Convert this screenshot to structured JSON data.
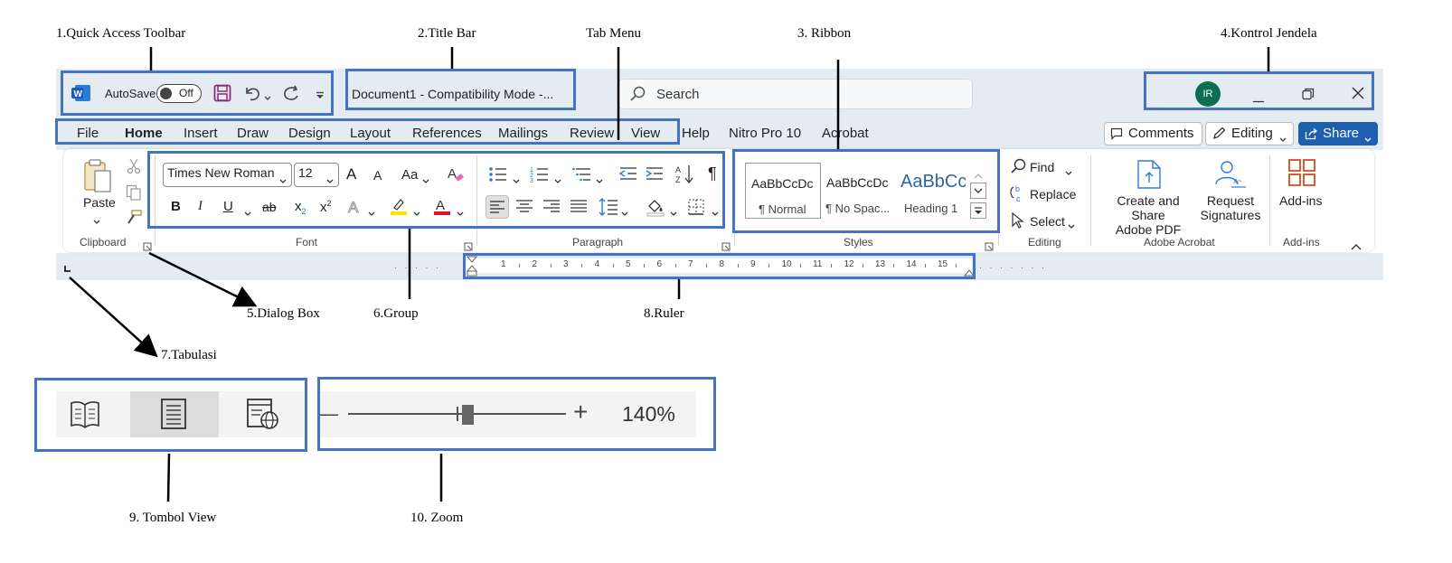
{
  "annotations": {
    "qat": "1.Quick Access Toolbar",
    "title_bar": "2.Title Bar",
    "tab_menu": "Tab Menu",
    "ribbon": "3. Ribbon",
    "window_controls": "4.Kontrol Jendela",
    "dialog_box": "5.Dialog Box",
    "group": "6.Group",
    "tabulasi": "7.Tabulasi",
    "ruler": "8.Ruler",
    "view_buttons": "9. Tombol View",
    "zoom": "10.  Zoom"
  },
  "window": {
    "autosave_label": "AutoSave",
    "autosave_state": "Off",
    "doc_title": "Document1  -  Compatibility Mode  -...",
    "search_placeholder": "Search",
    "avatar_initials": "IR"
  },
  "tabs": [
    "File",
    "Home",
    "Insert",
    "Draw",
    "Design",
    "Layout",
    "References",
    "Mailings",
    "Review",
    "View",
    "Help",
    "Nitro Pro 10",
    "Acrobat"
  ],
  "active_tab": "Home",
  "right_buttons": {
    "comments": "Comments",
    "editing": "Editing",
    "share": "Share"
  },
  "ribbon": {
    "clipboard": {
      "paste": "Paste",
      "group": "Clipboard"
    },
    "font": {
      "name": "Times New Roman",
      "size": "12",
      "case": "Aa",
      "group": "Font",
      "bold": "B",
      "italic": "I",
      "underline": "U",
      "strike": "ab",
      "sub": "x",
      "sup": "x",
      "grow": "A",
      "shrink": "A"
    },
    "paragraph": {
      "group": "Paragraph"
    },
    "styles": {
      "group": "Styles",
      "items": [
        {
          "preview": "AaBbCcDc",
          "name": "¶ Normal"
        },
        {
          "preview": "AaBbCcDc",
          "name": "¶ No Spac..."
        },
        {
          "preview": "AaBbCc",
          "name": "Heading 1"
        }
      ]
    },
    "editing": {
      "find": "Find",
      "replace": "Replace",
      "select": "Select",
      "group": "Editing"
    },
    "acrobat": {
      "create_line1": "Create and Share",
      "create_line2": "Adobe PDF",
      "request_line1": "Request",
      "request_line2": "Signatures",
      "group": "Adobe Acrobat"
    },
    "addins": {
      "label": "Add-ins",
      "group": "Add-ins"
    }
  },
  "ruler_numbers": [
    "1",
    "2",
    "3",
    "4",
    "5",
    "6",
    "7",
    "8",
    "9",
    "10",
    "11",
    "12",
    "13",
    "14",
    "15"
  ],
  "zoom": {
    "level": "140%",
    "minus": "—",
    "plus": "+"
  },
  "colors": {
    "accent": "#4472c4",
    "word_blue": "#185abd",
    "share_blue": "#1f5fb0",
    "qat_purple": "#8a2c7a",
    "avatar": "#0f6e52"
  }
}
